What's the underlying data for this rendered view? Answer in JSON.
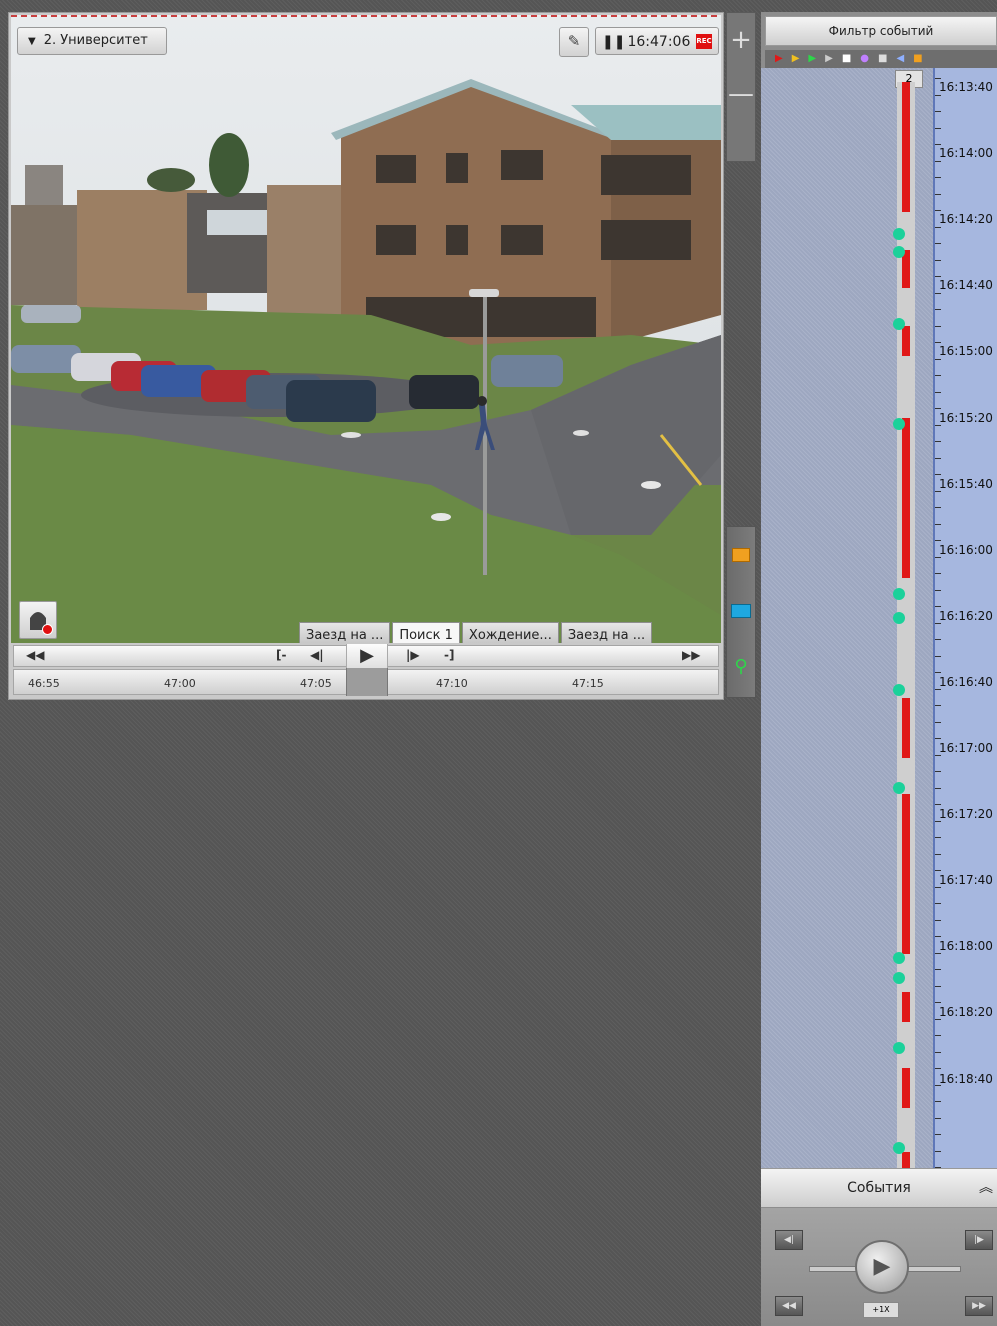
{
  "camera": {
    "title": "2. Университет",
    "clock_time": "16:47:06",
    "rec_label": "REC"
  },
  "tabs": [
    {
      "label": "Заезд на ...",
      "active": false
    },
    {
      "label": "Поиск 1",
      "active": true
    },
    {
      "label": "Хождение...",
      "active": false
    },
    {
      "label": "Заезд на ...",
      "active": false
    }
  ],
  "ruler_ticks": [
    "46:55",
    "47:00",
    "47:05",
    "47:10",
    "47:15"
  ],
  "controls": {
    "rewind": "◀◀",
    "prev_frame": "◀|",
    "mark_start": "[-",
    "play": "▶",
    "next_frame": "|▶",
    "mark_end": "-]",
    "ffwd": "▶▶"
  },
  "tools": {
    "zoom_in": "+",
    "zoom_out": "—"
  },
  "events_filter": {
    "title": "Фильтр событий",
    "track_number": "2",
    "time_labels": [
      "16:13:40",
      "16:14:00",
      "16:14:20",
      "16:14:40",
      "16:15:00",
      "16:15:20",
      "16:15:40",
      "16:16:00",
      "16:16:20",
      "16:16:40",
      "16:17:00",
      "16:17:20",
      "16:17:40",
      "16:18:00",
      "16:18:20",
      "16:18:40"
    ]
  },
  "events_panel": {
    "title": "События",
    "speed": "+1X"
  },
  "colors": {
    "recording": "#e01818",
    "event_marker": "#1bd19a",
    "timeline_bg": "#a6b7df",
    "accent_orange": "#f0a020"
  }
}
